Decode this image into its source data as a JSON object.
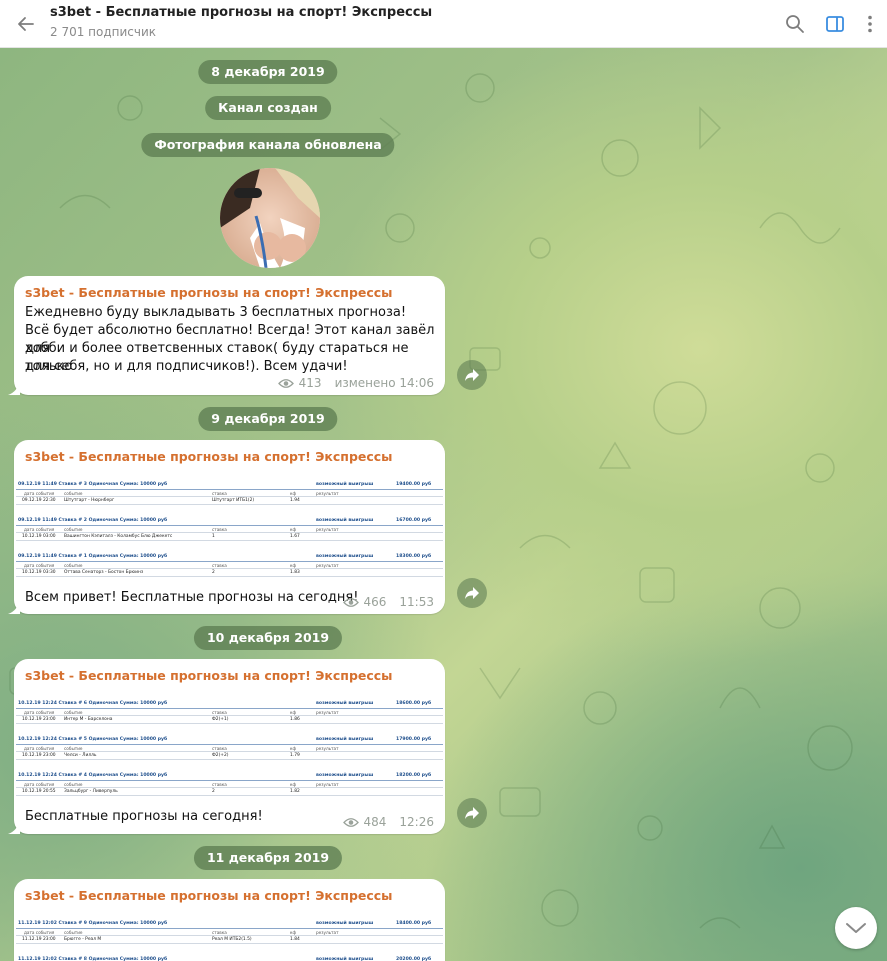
{
  "header": {
    "title": "s3bet - Бесплатные прогнозы на спорт! Экспрессы",
    "subscribers": "2 701 подписчик"
  },
  "pills": {
    "date1": "8 декабря 2019",
    "channel_created": "Канал создан",
    "photo_updated": "Фотография канала обновлена",
    "date2": "9 декабря 2019",
    "date3": "10 декабря 2019",
    "date4": "11 декабря 2019"
  },
  "messages": [
    {
      "sender": "s3bet - Бесплатные прогнозы на спорт! Экспрессы",
      "lines": [
        "Ежедневно буду выкладывать 3 бесплатных прогноза!",
        "Всё будет абсолютно бесплатно! Всегда! Этот канал завёл для",
        "хобби и более ответсвенных ставок( буду стараться не только",
        "для себя, но и для подписчиков!). Всем удачи!"
      ],
      "views": "413",
      "time": "изменено 14:06"
    },
    {
      "sender": "s3bet - Бесплатные прогнозы на спорт! Экспрессы",
      "caption": "Всем привет! Бесплатные прогнозы на сегодня!",
      "views": "466",
      "time": "11:53",
      "bets": [
        {
          "head": "09.12.19 11:49   Ставка # 3   Одиночная   Сумма: 10000 руб",
          "win": "возможный выигрыш",
          "win_val": "19400.00 руб",
          "date": "09.12.19 22:30",
          "event": "Штутгарт - Нюрнберг",
          "bet": "Штутгарт ИТБ1(2)",
          "kf": "1.94"
        },
        {
          "head": "09.12.19 11:49   Ставка # 2   Одиночная   Сумма: 10000 руб",
          "win": "возможный выигрыш",
          "win_val": "16700.00 руб",
          "date": "10.12.19 03:00",
          "event": "Вашингтон Кэпиталз - Коламбус Блю Джекетс",
          "bet": "1",
          "kf": "1.67"
        },
        {
          "head": "09.12.19 11:49   Ставка # 1   Одиночная   Сумма: 10000 руб",
          "win": "возможный выигрыш",
          "win_val": "18300.00 руб",
          "date": "10.12.19 03:30",
          "event": "Оттава Сенаторз - Бостон Брюинз",
          "bet": "2",
          "kf": "1.83"
        }
      ]
    },
    {
      "sender": "s3bet - Бесплатные прогнозы на спорт! Экспрессы",
      "caption": "Бесплатные прогнозы на сегодня!",
      "views": "484",
      "time": "12:26",
      "bets": [
        {
          "head": "10.12.19 12:24   Ставка # 6   Одиночная   Сумма: 10000 руб",
          "win": "возможный выигрыш",
          "win_val": "18600.00 руб",
          "date": "10.12.19 23:00",
          "event": "Интер М - Барселона",
          "bet": "Ф2(+1)",
          "kf": "1.86"
        },
        {
          "head": "10.12.19 12:24   Ставка # 5   Одиночная   Сумма: 10000 руб",
          "win": "возможный выигрыш",
          "win_val": "17900.00 руб",
          "date": "10.12.19 23:00",
          "event": "Челси - Лилль",
          "bet": "Ф2(+2)",
          "kf": "1.79"
        },
        {
          "head": "10.12.19 12:24   Ставка # 4   Одиночная   Сумма: 10000 руб",
          "win": "возможный выигрыш",
          "win_val": "18200.00 руб",
          "date": "10.12.19 20:55",
          "event": "Зальцбург - Ливерпуль",
          "bet": "2",
          "kf": "1.82"
        }
      ]
    },
    {
      "sender": "s3bet - Бесплатные прогнозы на спорт! Экспрессы",
      "bets": [
        {
          "head": "11.12.19 12:02   Ставка # 9   Одиночная   Сумма: 10000 руб",
          "win": "возможный выигрыш",
          "win_val": "18400.00 руб",
          "date": "11.12.19 23:00",
          "event": "Брюгге - Реал М",
          "bet": "Реал М ИТБ2(1.5)",
          "kf": "1.84"
        },
        {
          "head": "11.12.19 12:02   Ставка # 8   Одиночная   Сумма: 10000 руб",
          "win": "возможный выигрыш",
          "win_val": "20200.00 руб",
          "date": "",
          "event": "",
          "bet": "",
          "kf": ""
        }
      ]
    }
  ],
  "table_labels": {
    "date": "дата события",
    "event": "событие",
    "bet": "ставка",
    "kf": "кф",
    "result": "результат"
  },
  "colors": {
    "sender": "#d5702f",
    "pill_bg": "#5d7e52",
    "accent": "#3a8de0"
  }
}
